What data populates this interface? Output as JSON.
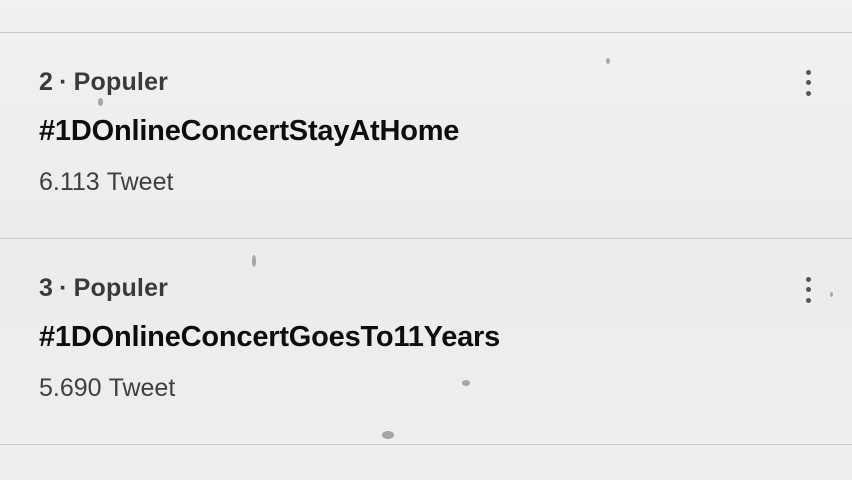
{
  "trends": [
    {
      "rank": "2",
      "separator": "·",
      "category": "Populer",
      "hashtag": "#1DOnlineConcertStayAtHome",
      "count": "6.113",
      "count_label": "Tweet",
      "more_icon": "more-vertical-icon"
    },
    {
      "rank": "3",
      "separator": "·",
      "category": "Populer",
      "hashtag": "#1DOnlineConcertGoesTo11Years",
      "count": "5.690",
      "count_label": "Tweet",
      "more_icon": "more-vertical-icon"
    }
  ],
  "colors": {
    "background": "#eeeeec",
    "divider": "#c9c9c7",
    "hashtag_text": "#0d0d0d",
    "meta_text": "#3a3a3a"
  }
}
